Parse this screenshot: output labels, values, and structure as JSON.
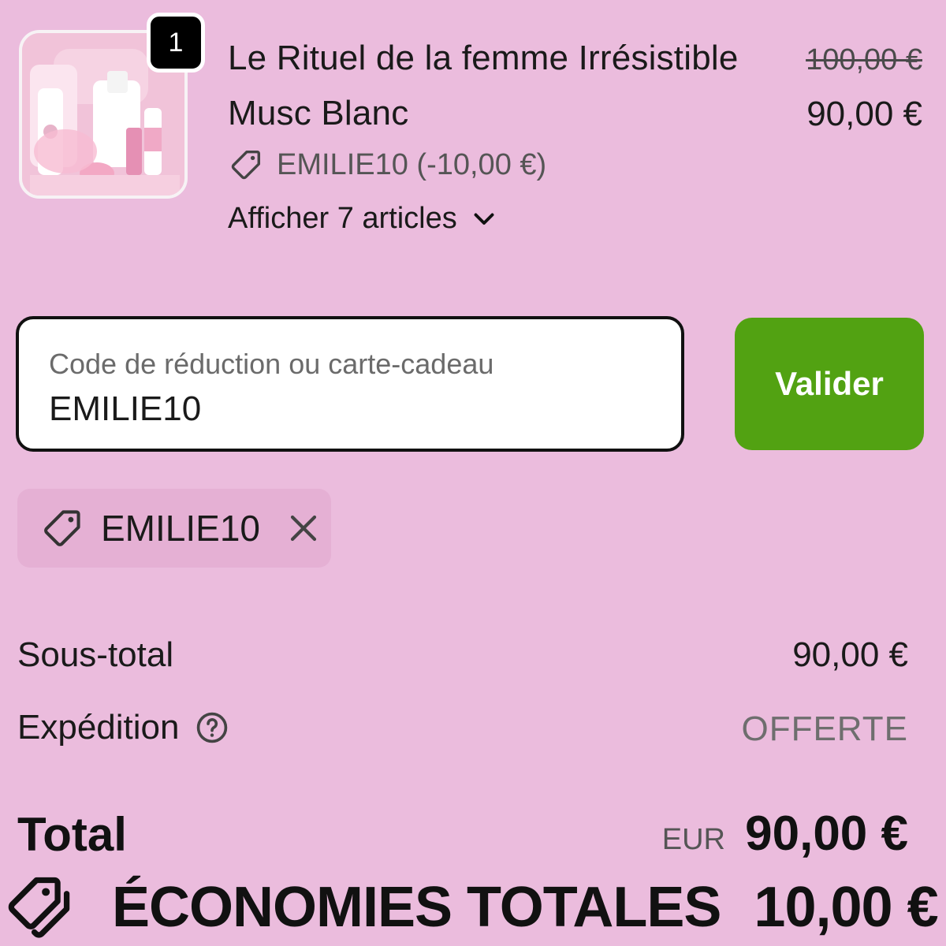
{
  "order_item": {
    "quantity": "1",
    "title_line_1": "Le Rituel de la femme Irrésistible",
    "title_line_2": "Musc Blanc",
    "original_price": "100,00 €",
    "price": "90,00 €",
    "discount_line": "EMILIE10 (-10,00 €)",
    "show_items": "Afficher 7 articles"
  },
  "discount_field": {
    "label": "Code de réduction ou carte-cadeau",
    "value": "EMILIE10",
    "button_label": "Valider"
  },
  "applied_code": {
    "code": "EMILIE10"
  },
  "summary": {
    "subtotal_label": "Sous-total",
    "subtotal_value": "90,00 €",
    "shipping_label": "Expédition",
    "shipping_value": "OFFERTE",
    "total_label": "Total",
    "total_currency": "EUR",
    "total_value": "90,00 €",
    "savings_label": "ÉCONOMIES TOTALES",
    "savings_value": "10,00 €"
  },
  "icons": {
    "tag": "tag-icon",
    "chevron": "chevron-down-icon",
    "close": "close-icon",
    "help": "help-circle-icon"
  },
  "colors": {
    "background": "#ebbcdd",
    "button": "#52a212",
    "chip": "#e5b0d4"
  }
}
